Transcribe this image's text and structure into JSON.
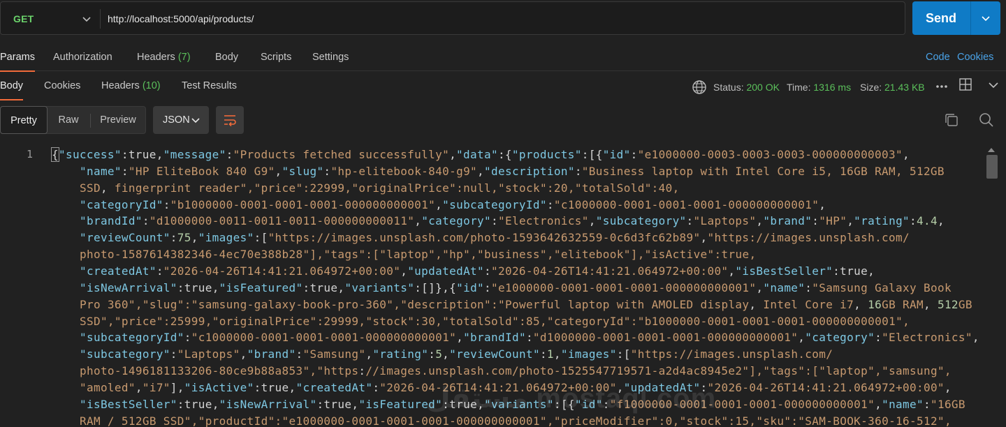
{
  "request": {
    "method": "GET",
    "url": "http://localhost:5000/api/products/",
    "send_label": "Send"
  },
  "request_tabs": [
    {
      "label": "Params",
      "count": ""
    },
    {
      "label": "Authorization",
      "count": ""
    },
    {
      "label": "Headers",
      "count": "(7)"
    },
    {
      "label": "Body",
      "count": ""
    },
    {
      "label": "Scripts",
      "count": ""
    },
    {
      "label": "Settings",
      "count": ""
    }
  ],
  "request_links": {
    "code": "Code",
    "cookies": "Cookies"
  },
  "response_tabs": [
    {
      "label": "Body",
      "count": ""
    },
    {
      "label": "Cookies",
      "count": ""
    },
    {
      "label": "Headers",
      "count": "(10)"
    },
    {
      "label": "Test Results",
      "count": ""
    }
  ],
  "status": {
    "status_label": "Status:",
    "status_value": "200 OK",
    "time_label": "Time:",
    "time_value": "1316 ms",
    "size_label": "Size:",
    "size_value": "21.43 KB"
  },
  "view_modes": {
    "pretty": "Pretty",
    "raw": "Raw",
    "preview": "Preview"
  },
  "format": "JSON",
  "line_number": "1",
  "watermark": "مستقل mostaql.com",
  "code_lines": [
    {
      "indent": false,
      "text": "{\"success\":true,\"message\":\"Products fetched successfully\",\"data\":{\"products\":[{\"id\":\"e1000000-0003-0003-0003-000000000003\","
    },
    {
      "indent": true,
      "text": "\"name\":\"HP EliteBook 840 G9\",\"slug\":\"hp-elitebook-840-g9\",\"description\":\"Business laptop with Intel Core i5, 16GB RAM, 512GB"
    },
    {
      "indent": true,
      "text": "SSD, fingerprint reader\",\"price\":22999,\"originalPrice\":null,\"stock\":20,\"totalSold\":40,"
    },
    {
      "indent": true,
      "text": "\"categoryId\":\"b1000000-0001-0001-0001-000000000001\",\"subcategoryId\":\"c1000000-0001-0001-0001-000000000001\","
    },
    {
      "indent": true,
      "text": "\"brandId\":\"d1000000-0011-0011-0011-000000000011\",\"category\":\"Electronics\",\"subcategory\":\"Laptops\",\"brand\":\"HP\",\"rating\":4.4,"
    },
    {
      "indent": true,
      "text": "\"reviewCount\":75,\"images\":[\"https://images.unsplash.com/photo-1593642632559-0c6d3fc62b89\",\"https://images.unsplash.com/"
    },
    {
      "indent": true,
      "text": "photo-1587614382346-4ec70e388b28\"],\"tags\":[\"laptop\",\"hp\",\"business\",\"elitebook\"],\"isActive\":true,"
    },
    {
      "indent": true,
      "text": "\"createdAt\":\"2026-04-26T14:41:21.064972+00:00\",\"updatedAt\":\"2026-04-26T14:41:21.064972+00:00\",\"isBestSeller\":true,"
    },
    {
      "indent": true,
      "text": "\"isNewArrival\":true,\"isFeatured\":true,\"variants\":[]},{\"id\":\"e1000000-0001-0001-0001-000000000001\",\"name\":\"Samsung Galaxy Book"
    },
    {
      "indent": true,
      "text": "Pro 360\",\"slug\":\"samsung-galaxy-book-pro-360\",\"description\":\"Powerful laptop with AMOLED display, Intel Core i7, 16GB RAM, 512GB"
    },
    {
      "indent": true,
      "text": "SSD\",\"price\":25999,\"originalPrice\":29999,\"stock\":30,\"totalSold\":85,\"categoryId\":\"b1000000-0001-0001-0001-000000000001\","
    },
    {
      "indent": true,
      "text": "\"subcategoryId\":\"c1000000-0001-0001-0001-000000000001\",\"brandId\":\"d1000000-0001-0001-0001-000000000001\",\"category\":\"Electronics\","
    },
    {
      "indent": true,
      "text": "\"subcategory\":\"Laptops\",\"brand\":\"Samsung\",\"rating\":5,\"reviewCount\":1,\"images\":[\"https://images.unsplash.com/"
    },
    {
      "indent": true,
      "text": "photo-1496181133206-80ce9b88a853\",\"https://images.unsplash.com/photo-1525547719571-a2d4ac8945e2\"],\"tags\":[\"laptop\",\"samsung\","
    },
    {
      "indent": true,
      "text": "\"amoled\",\"i7\"],\"isActive\":true,\"createdAt\":\"2026-04-26T14:41:21.064972+00:00\",\"updatedAt\":\"2026-04-26T14:41:21.064972+00:00\","
    },
    {
      "indent": true,
      "text": "\"isBestSeller\":true,\"isNewArrival\":true,\"isFeatured\":true,\"variants\":[{\"id\":\"f1000000-0001-0001-0001-000000000001\",\"name\":\"16GB"
    },
    {
      "indent": true,
      "text": "RAM / 512GB SSD\",\"productId\":\"e1000000-0001-0001-0001-000000000001\",\"priceModifier\":0,\"stock\":15,\"sku\":\"SAM-BOOK-360-16-512\","
    }
  ]
}
